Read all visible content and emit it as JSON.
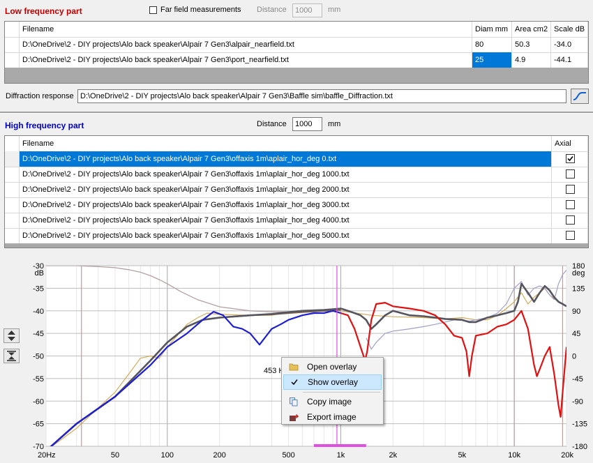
{
  "low": {
    "title": "Low frequency part",
    "far_field_label": "Far field measurements",
    "distance_label": "Distance",
    "distance_value": "1000",
    "unit": "mm",
    "columns": [
      "Filename",
      "Diam mm",
      "Area cm2",
      "Scale dB"
    ],
    "rows": [
      {
        "file": "D:\\OneDrive\\2 - DIY projects\\Alo back speaker\\Alpair 7 Gen3\\alpair_nearfield.txt",
        "diam": "80",
        "area": "50.3",
        "scale": "-34.0"
      },
      {
        "file": "D:\\OneDrive\\2 - DIY projects\\Alo back speaker\\Alpair 7 Gen3\\port_nearfield.txt",
        "diam": "25",
        "area": "4.9",
        "scale": "-44.1"
      }
    ]
  },
  "diffraction": {
    "label": "Diffraction response",
    "value": "D:\\OneDrive\\2 - DIY projects\\Alo back speaker\\Alpair 7 Gen3\\Baffle sim\\baffle_Diffraction.txt"
  },
  "high": {
    "title": "High frequency part",
    "distance_label": "Distance",
    "distance_value": "1000",
    "unit": "mm",
    "columns": [
      "Filename",
      "Axial"
    ],
    "rows": [
      {
        "file": "D:\\OneDrive\\2 - DIY projects\\Alo back speaker\\Alpair 7 Gen3\\offaxis 1m\\aplair_hor_deg 0.txt",
        "axial": true
      },
      {
        "file": "D:\\OneDrive\\2 - DIY projects\\Alo back speaker\\Alpair 7 Gen3\\offaxis 1m\\aplair_hor_deg 1000.txt",
        "axial": false
      },
      {
        "file": "D:\\OneDrive\\2 - DIY projects\\Alo back speaker\\Alpair 7 Gen3\\offaxis 1m\\aplair_hor_deg 2000.txt",
        "axial": false
      },
      {
        "file": "D:\\OneDrive\\2 - DIY projects\\Alo back speaker\\Alpair 7 Gen3\\offaxis 1m\\aplair_hor_deg 3000.txt",
        "axial": false
      },
      {
        "file": "D:\\OneDrive\\2 - DIY projects\\Alo back speaker\\Alpair 7 Gen3\\offaxis 1m\\aplair_hor_deg 4000.txt",
        "axial": false
      },
      {
        "file": "D:\\OneDrive\\2 - DIY projects\\Alo back speaker\\Alpair 7 Gen3\\offaxis 1m\\aplair_hor_deg 5000.txt",
        "axial": false
      }
    ]
  },
  "context_menu": {
    "items": [
      {
        "label": "Open overlay",
        "icon": "folder-icon"
      },
      {
        "label": "Show overlay",
        "icon": "check-icon"
      },
      {
        "label": "Copy image",
        "icon": "copy-icon"
      },
      {
        "label": "Export image",
        "icon": "export-icon"
      }
    ]
  },
  "chart_data": {
    "type": "line",
    "xscale": "log",
    "xlim": [
      20,
      20000
    ],
    "ylim": [
      -70,
      -30
    ],
    "y2lim": [
      -180,
      180
    ],
    "ylabel_unit": "dB",
    "y2label_unit": "deg",
    "x_tick_labels": [
      "20Hz",
      "50",
      "100",
      "200",
      "500",
      "1k",
      "2k",
      "5k",
      "10k",
      "20k"
    ],
    "x_tick_values": [
      20,
      50,
      100,
      200,
      500,
      1000,
      2000,
      5000,
      10000,
      20000
    ],
    "y_ticks": [
      -30,
      -35,
      -40,
      -45,
      -50,
      -55,
      -60,
      -65,
      -70
    ],
    "y2_ticks": [
      180,
      135,
      90,
      45,
      0,
      -45,
      -90,
      -135,
      -180
    ],
    "cursor_readout": "453 Hz, -50.",
    "cursor_x": 950,
    "grid": true,
    "colors": {
      "blue": "#1e1ed2",
      "red": "#e01010",
      "gray": "#55555f",
      "brown": "#826450",
      "tan": "#d2aa5a",
      "phase": "#b4a0a0",
      "lavender": "#a0a0c8",
      "cursor": "#e050e0"
    },
    "series": [
      {
        "color_key": "blue",
        "points": [
          [
            20,
            -71
          ],
          [
            30,
            -65
          ],
          [
            50,
            -59
          ],
          [
            80,
            -52
          ],
          [
            100,
            -48
          ],
          [
            130,
            -45
          ],
          [
            160,
            -42
          ],
          [
            185,
            -40.2
          ],
          [
            210,
            -41
          ],
          [
            240,
            -43.5
          ],
          [
            270,
            -44
          ],
          [
            300,
            -45
          ],
          [
            340,
            -47.5
          ],
          [
            400,
            -44
          ],
          [
            450,
            -43
          ],
          [
            500,
            -42
          ],
          [
            600,
            -41
          ],
          [
            700,
            -40.5
          ],
          [
            800,
            -40.5
          ],
          [
            900,
            -40
          ],
          [
            1000,
            -40.5
          ]
        ]
      },
      {
        "color_key": "red",
        "points": [
          [
            1000,
            -40.5
          ],
          [
            1100,
            -41
          ],
          [
            1200,
            -44
          ],
          [
            1300,
            -48
          ],
          [
            1380,
            -51
          ],
          [
            1420,
            -49
          ],
          [
            1500,
            -42
          ],
          [
            1600,
            -38.5
          ],
          [
            1800,
            -38.2
          ],
          [
            2000,
            -39
          ],
          [
            2500,
            -39.5
          ],
          [
            3000,
            -40
          ],
          [
            3500,
            -41
          ],
          [
            4000,
            -43
          ],
          [
            4500,
            -45.5
          ],
          [
            5000,
            -46
          ],
          [
            5300,
            -49
          ],
          [
            5500,
            -54.5
          ],
          [
            5700,
            -50
          ],
          [
            6000,
            -45.5
          ],
          [
            7000,
            -45
          ],
          [
            8000,
            -43.5
          ],
          [
            9000,
            -43
          ],
          [
            10000,
            -42
          ],
          [
            11000,
            -40
          ],
          [
            12000,
            -44
          ],
          [
            13000,
            -52
          ],
          [
            13500,
            -54.5
          ],
          [
            14000,
            -53
          ],
          [
            15000,
            -50
          ],
          [
            16000,
            -48
          ],
          [
            17000,
            -54
          ],
          [
            18000,
            -61
          ],
          [
            18500,
            -63.5
          ],
          [
            19000,
            -58
          ],
          [
            20000,
            -48
          ]
        ]
      },
      {
        "color_key": "gray",
        "points": [
          [
            20,
            -71
          ],
          [
            30,
            -65
          ],
          [
            50,
            -59
          ],
          [
            80,
            -51
          ],
          [
            100,
            -47
          ],
          [
            130,
            -43.5
          ],
          [
            160,
            -42
          ],
          [
            200,
            -41.5
          ],
          [
            300,
            -41
          ],
          [
            400,
            -40.7
          ],
          [
            500,
            -40.3
          ],
          [
            600,
            -40
          ],
          [
            800,
            -39.8
          ],
          [
            1000,
            -39.5
          ],
          [
            1100,
            -40
          ],
          [
            1200,
            -40.5
          ],
          [
            1300,
            -41
          ],
          [
            1400,
            -42
          ],
          [
            1500,
            -44
          ],
          [
            1600,
            -43
          ],
          [
            1800,
            -41
          ],
          [
            2000,
            -40
          ],
          [
            2500,
            -41
          ],
          [
            3000,
            -41.2
          ],
          [
            3500,
            -41.5
          ],
          [
            4000,
            -41.8
          ],
          [
            5000,
            -42
          ],
          [
            5500,
            -42.5
          ],
          [
            6000,
            -42.5
          ],
          [
            7000,
            -41.5
          ],
          [
            8000,
            -41
          ],
          [
            9000,
            -40.5
          ],
          [
            10000,
            -40
          ],
          [
            10500,
            -38
          ],
          [
            11000,
            -34
          ],
          [
            12000,
            -36
          ],
          [
            13000,
            -38
          ],
          [
            14000,
            -36
          ],
          [
            15000,
            -34.5
          ],
          [
            16000,
            -35.5
          ],
          [
            17000,
            -37
          ],
          [
            18000,
            -38
          ],
          [
            19000,
            -38.5
          ],
          [
            20000,
            -39
          ]
        ]
      },
      {
        "color_key": "brown",
        "points": [
          [
            20,
            -71
          ],
          [
            30,
            -65
          ],
          [
            50,
            -59
          ],
          [
            80,
            -51
          ],
          [
            100,
            -47
          ],
          [
            130,
            -43.5
          ],
          [
            160,
            -42
          ],
          [
            200,
            -41.5
          ],
          [
            300,
            -41
          ],
          [
            400,
            -40.8
          ],
          [
            500,
            -40.5
          ],
          [
            600,
            -40.3
          ],
          [
            800,
            -40
          ],
          [
            1000,
            -39.8
          ]
        ]
      },
      {
        "color_key": "tan",
        "points": [
          [
            20,
            -71
          ],
          [
            30,
            -66
          ],
          [
            50,
            -58
          ],
          [
            60,
            -54
          ],
          [
            70,
            -50.5
          ],
          [
            80,
            -50
          ],
          [
            90,
            -50.5
          ],
          [
            100,
            -48
          ],
          [
            130,
            -43
          ],
          [
            150,
            -41.5
          ],
          [
            170,
            -40.5
          ],
          [
            200,
            -40.8
          ],
          [
            300,
            -41
          ],
          [
            400,
            -41
          ],
          [
            500,
            -40.3
          ],
          [
            600,
            -40.3
          ],
          [
            800,
            -40
          ],
          [
            1000,
            -40
          ],
          [
            1500,
            -41
          ],
          [
            2000,
            -41.3
          ],
          [
            3000,
            -41.5
          ],
          [
            4000,
            -41.8
          ],
          [
            5000,
            -41.5
          ],
          [
            6000,
            -42
          ],
          [
            7000,
            -42
          ],
          [
            8000,
            -41
          ],
          [
            9000,
            -39.5
          ],
          [
            10000,
            -38
          ],
          [
            11000,
            -36
          ],
          [
            12000,
            -38.5
          ],
          [
            13000,
            -37
          ],
          [
            14000,
            -36
          ],
          [
            15000,
            -35
          ],
          [
            16000,
            -36.5
          ],
          [
            18000,
            -38
          ],
          [
            20000,
            -39
          ]
        ]
      },
      {
        "color_key": "lavender",
        "points": [
          [
            1400,
            -46
          ],
          [
            1500,
            -48.5
          ],
          [
            1600,
            -47
          ],
          [
            1800,
            -45
          ],
          [
            2000,
            -44.5
          ],
          [
            2500,
            -44
          ],
          [
            3000,
            -43.5
          ],
          [
            3500,
            -43
          ],
          [
            4000,
            -42.5
          ],
          [
            4500,
            -42
          ],
          [
            5000,
            -42
          ],
          [
            5500,
            -42.3
          ],
          [
            6000,
            -42
          ],
          [
            7000,
            -41.5
          ],
          [
            8000,
            -40.5
          ],
          [
            9000,
            -38.5
          ],
          [
            10000,
            -35
          ],
          [
            11000,
            -33.5
          ],
          [
            12000,
            -36.5
          ],
          [
            13000,
            -35
          ],
          [
            14000,
            -34.5
          ],
          [
            15000,
            -35
          ],
          [
            16000,
            -36.5
          ],
          [
            17000,
            -37.5
          ],
          [
            18000,
            -34
          ],
          [
            19000,
            -32
          ],
          [
            20000,
            -31
          ]
        ]
      }
    ],
    "phase_series": {
      "color_key": "phase",
      "points": [
        [
          20,
          180
        ],
        [
          30,
          180
        ],
        [
          40,
          178
        ],
        [
          50,
          176
        ],
        [
          60,
          172
        ],
        [
          70,
          167
        ],
        [
          80,
          160
        ],
        [
          90,
          152
        ],
        [
          100,
          144
        ],
        [
          120,
          128
        ],
        [
          150,
          112
        ],
        [
          200,
          98
        ],
        [
          300,
          90
        ],
        [
          400,
          88
        ],
        [
          500,
          88
        ],
        [
          800,
          90
        ],
        [
          1000,
          90
        ]
      ]
    },
    "markers": {
      "vlines": [
        32,
        10000,
        19000
      ],
      "marker_band": [
        700,
        1400
      ]
    }
  }
}
